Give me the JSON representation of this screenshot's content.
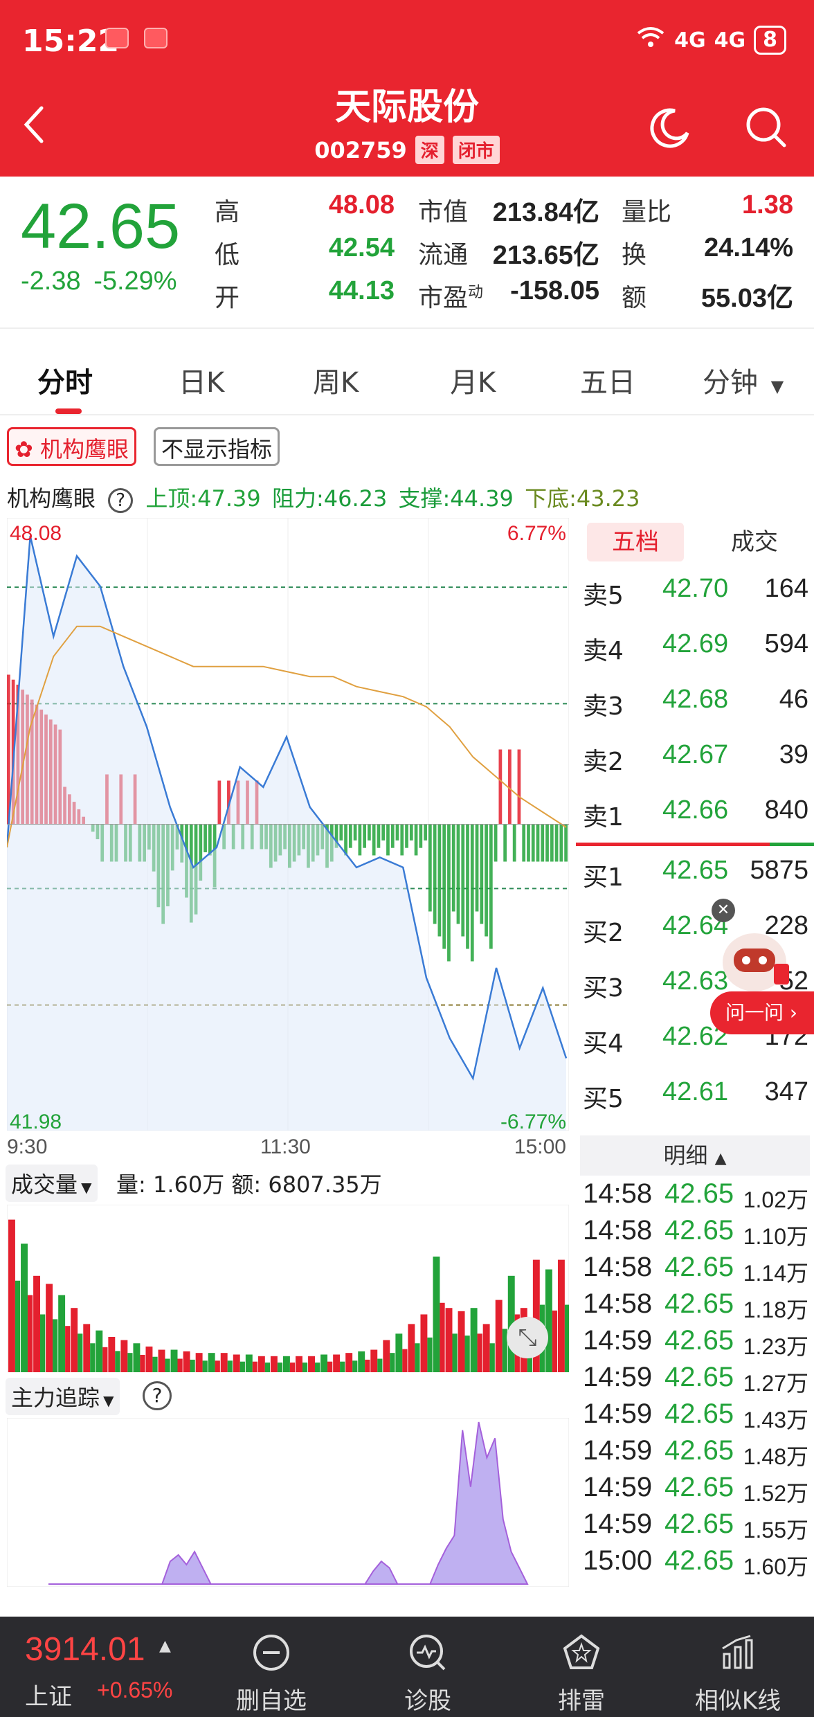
{
  "status": {
    "time": "15:22",
    "signal1": "4G",
    "signal2": "4G",
    "battery": "8"
  },
  "header": {
    "title": "天际股份",
    "code": "002759",
    "market_tag": "深",
    "state_tag": "闭市"
  },
  "quote": {
    "price": "42.65",
    "change": "-2.38",
    "change_pct": "-5.29%",
    "high_label": "高",
    "high": "48.08",
    "low_label": "低",
    "low": "42.54",
    "open_label": "开",
    "open": "44.13",
    "mcap_label": "市值",
    "mcap": "213.84亿",
    "float_label": "流通",
    "float": "213.65亿",
    "pe_label": "市盈",
    "pe_sup": "动",
    "pe": "-158.05",
    "vr_label": "量比",
    "vr": "1.38",
    "turnover_label": "换",
    "turnover": "24.14%",
    "amount_label": "额",
    "amount": "55.03亿"
  },
  "tabs": [
    "分时",
    "日K",
    "周K",
    "月K",
    "五日",
    "分钟"
  ],
  "buttons": {
    "eagle": "机构鹰眼",
    "hide_indicator": "不显示指标"
  },
  "eagle": {
    "name": "机构鹰眼",
    "top": "上顶:47.39",
    "resist": "阻力:46.23",
    "support": "支撑:44.39",
    "bottom": "下底:43.23"
  },
  "chart": {
    "max_price": "48.08",
    "min_price": "41.98",
    "max_pct": "6.77%",
    "min_pct": "-6.77%",
    "t_start": "9:30",
    "t_mid": "11:30",
    "t_end": "15:00"
  },
  "chart_data": {
    "type": "line",
    "title": "",
    "xlabel": "",
    "ylabel": "",
    "x": [
      "9:30",
      "9:40",
      "9:50",
      "10:00",
      "10:10",
      "10:20",
      "10:30",
      "10:40",
      "10:50",
      "11:00",
      "11:10",
      "11:20",
      "11:30",
      "13:10",
      "13:20",
      "13:30",
      "13:40",
      "13:50",
      "14:00",
      "14:10",
      "14:20",
      "14:30",
      "14:40",
      "14:50",
      "15:00"
    ],
    "ylim": [
      41.98,
      48.08
    ],
    "series": [
      {
        "values": [
          44.8,
          47.9,
          46.9,
          47.7,
          47.4,
          46.6,
          46.0,
          45.2,
          44.6,
          44.8,
          45.6,
          45.4,
          45.9,
          45.2,
          44.9,
          44.6,
          44.7,
          44.6,
          43.5,
          42.9,
          42.5,
          43.6,
          42.8,
          43.4,
          42.7
        ]
      },
      {
        "values": [
          44.8,
          46.0,
          46.7,
          47.0,
          47.0,
          46.9,
          46.8,
          46.7,
          46.6,
          46.6,
          46.6,
          46.6,
          46.55,
          46.5,
          46.5,
          46.4,
          46.35,
          46.3,
          46.2,
          46.0,
          45.7,
          45.5,
          45.3,
          45.15,
          45.0
        ]
      }
    ]
  },
  "volume": {
    "label": "成交量",
    "text": "量: 1.60万 额: 6807.35万",
    "values": [
      95,
      80,
      60,
      55,
      48,
      40,
      30,
      26,
      22,
      20,
      18,
      16,
      14,
      14,
      13,
      12,
      12,
      12,
      11,
      11,
      10,
      10,
      10,
      10,
      10,
      11,
      11,
      12,
      13,
      14,
      20,
      24,
      30,
      36,
      72,
      40,
      38,
      40,
      30,
      45,
      60,
      40,
      70,
      64,
      70
    ]
  },
  "main_force": {
    "label": "主力追踪",
    "values": [
      0,
      0,
      0,
      0,
      0,
      0,
      0,
      0,
      0,
      0,
      0,
      0,
      0,
      0,
      0,
      14,
      18,
      12,
      20,
      10,
      0,
      0,
      0,
      0,
      0,
      0,
      0,
      0,
      0,
      0,
      0,
      0,
      0,
      0,
      0,
      0,
      0,
      0,
      0,
      0,
      8,
      14,
      10,
      0,
      0,
      0,
      0,
      0,
      12,
      22,
      30,
      95,
      60,
      100,
      78,
      90,
      40,
      20,
      10,
      0
    ]
  },
  "orderbook": {
    "tab_five": "五档",
    "tab_deal": "成交",
    "asks": [
      {
        "label": "卖5",
        "price": "42.70",
        "vol": "164"
      },
      {
        "label": "卖4",
        "price": "42.69",
        "vol": "594"
      },
      {
        "label": "卖3",
        "price": "42.68",
        "vol": "46"
      },
      {
        "label": "卖2",
        "price": "42.67",
        "vol": "39"
      },
      {
        "label": "卖1",
        "price": "42.66",
        "vol": "840"
      }
    ],
    "bids": [
      {
        "label": "买1",
        "price": "42.65",
        "vol": "5875"
      },
      {
        "label": "买2",
        "price": "42.64",
        "vol": "228"
      },
      {
        "label": "买3",
        "price": "42.63",
        "vol": "52"
      },
      {
        "label": "买4",
        "price": "42.62",
        "vol": "172"
      },
      {
        "label": "买5",
        "price": "42.61",
        "vol": "347"
      }
    ]
  },
  "details": {
    "header": "明细",
    "rows": [
      {
        "time": "14:58",
        "price": "42.65",
        "vol": "1.02万"
      },
      {
        "time": "14:58",
        "price": "42.65",
        "vol": "1.10万"
      },
      {
        "time": "14:58",
        "price": "42.65",
        "vol": "1.14万"
      },
      {
        "time": "14:58",
        "price": "42.65",
        "vol": "1.18万"
      },
      {
        "time": "14:59",
        "price": "42.65",
        "vol": "1.23万"
      },
      {
        "time": "14:59",
        "price": "42.65",
        "vol": "1.27万"
      },
      {
        "time": "14:59",
        "price": "42.65",
        "vol": "1.43万"
      },
      {
        "time": "14:59",
        "price": "42.65",
        "vol": "1.48万"
      },
      {
        "time": "14:59",
        "price": "42.65",
        "vol": "1.52万"
      },
      {
        "time": "14:59",
        "price": "42.65",
        "vol": "1.55万"
      },
      {
        "time": "15:00",
        "price": "42.65",
        "vol": "1.60万"
      }
    ]
  },
  "ask_button": "问一问",
  "bottom": {
    "index_value": "3914.01",
    "index_name": "上证",
    "index_change": "+0.65%",
    "nav": [
      "删自选",
      "诊股",
      "排雷",
      "相似K线"
    ]
  },
  "colors": {
    "brand_red": "#e9252f",
    "up_red": "#e4202e",
    "down_green": "#22a33a",
    "line_blue": "#3a7bd5",
    "avg_orange": "#e0a040",
    "purple": "#9b4fd8"
  }
}
